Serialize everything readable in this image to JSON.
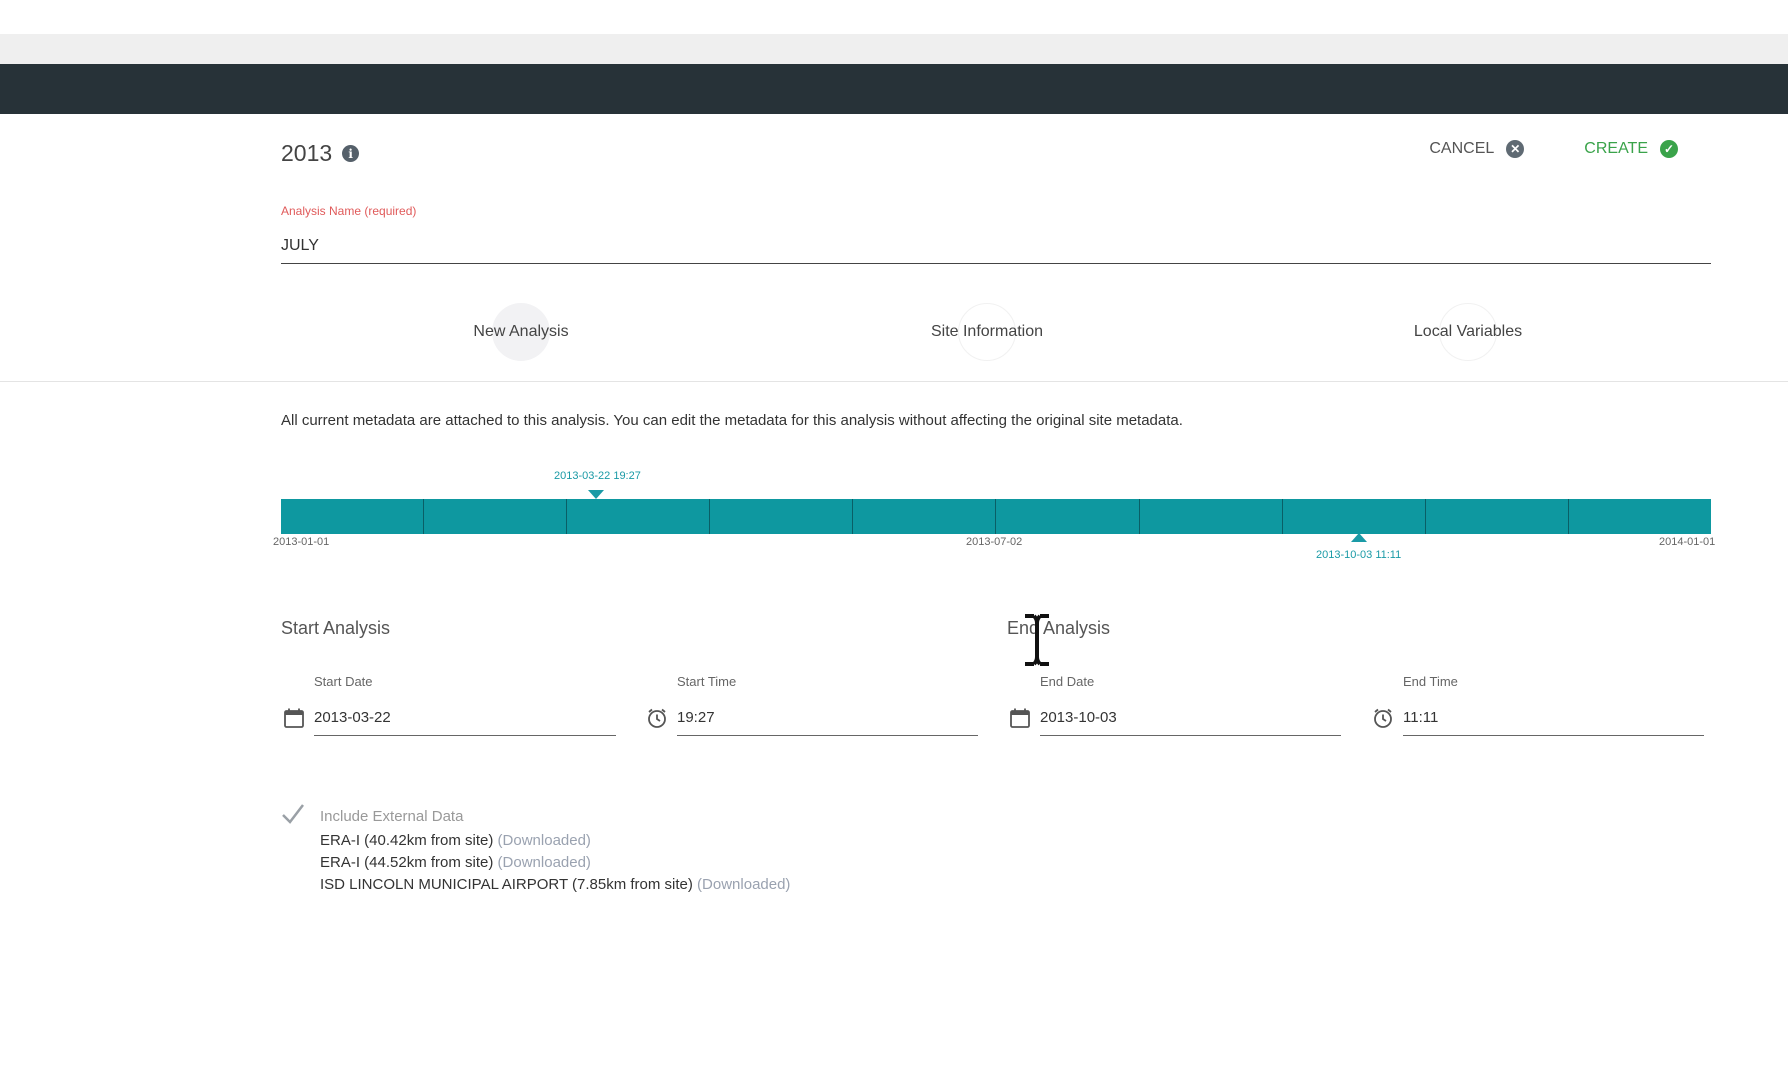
{
  "header": {
    "title": "2013",
    "cancel_label": "CANCEL",
    "create_label": "CREATE"
  },
  "analysis_name": {
    "label": "Analysis Name (required)",
    "value": "JULY"
  },
  "steps": [
    {
      "label": "New Analysis",
      "active": true
    },
    {
      "label": "Site Information",
      "active": false
    },
    {
      "label": "Local Variables",
      "active": false
    }
  ],
  "notice": "All current metadata are attached to this analysis.  You can edit the metadata for this analysis without affecting the original site metadata.",
  "timeline": {
    "start_label": "2013-01-01",
    "mid_label": "2013-07-02",
    "end_label": "2014-01-01",
    "start_marker": "2013-03-22 19:27",
    "end_marker": "2013-10-03 11:11",
    "bar_color": "#0e98a0",
    "marker_color": "#1a9aa6"
  },
  "start_analysis": {
    "title": "Start Analysis",
    "date_label": "Start Date",
    "date_value": "2013-03-22",
    "time_label": "Start Time",
    "time_value": "19:27"
  },
  "end_analysis": {
    "title": "End Analysis",
    "date_label": "End Date",
    "date_value": "2013-10-03",
    "time_label": "End Time",
    "time_value": "11:11"
  },
  "external_data": {
    "title": "Include External Data",
    "items": [
      {
        "name": "ERA-I (40.42km from site)",
        "status": "(Downloaded)"
      },
      {
        "name": "ERA-I (44.52km from site)",
        "status": "(Downloaded)"
      },
      {
        "name": "ISD LINCOLN MUNICIPAL AIRPORT (7.85km from site)",
        "status": "(Downloaded)"
      }
    ]
  },
  "colors": {
    "header_dark": "#273238",
    "create_green": "#3aa34a",
    "required_red": "#e05a5a"
  }
}
